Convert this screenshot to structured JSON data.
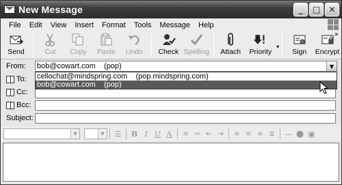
{
  "window": {
    "title": "New Message"
  },
  "title_buttons": {
    "minimize": "_",
    "maximize": "□",
    "close": "✕"
  },
  "menu": [
    "File",
    "Edit",
    "View",
    "Insert",
    "Format",
    "Tools",
    "Message",
    "Help"
  ],
  "toolbar": {
    "send": "Send",
    "cut": "Cut",
    "copy": "Copy",
    "paste": "Paste",
    "undo": "Undo",
    "check": "Check",
    "spelling": "Spelling",
    "attach": "Attach",
    "priority": "Priority",
    "sign": "Sign",
    "encrypt": "Encrypt",
    "overflow": "»"
  },
  "header": {
    "from_label": "From:",
    "from_value": "bob@cowart.com    (pop)",
    "to_label": "To:",
    "cc_label": "Cc:",
    "bcc_label": "Bcc:",
    "subject_label": "Subject:"
  },
  "from_options": [
    "cellochat@mindspring.com    (pop.mindspring.com)",
    "bob@cowart.com    (pop)"
  ],
  "format_buttons": {
    "bold": "B",
    "italic": "I",
    "underline": "U",
    "font_color": "A"
  },
  "colors": {
    "titlebar": "#3c3c3c",
    "selection": "#5a5a5a",
    "window_bg": "#e6e6e6"
  }
}
